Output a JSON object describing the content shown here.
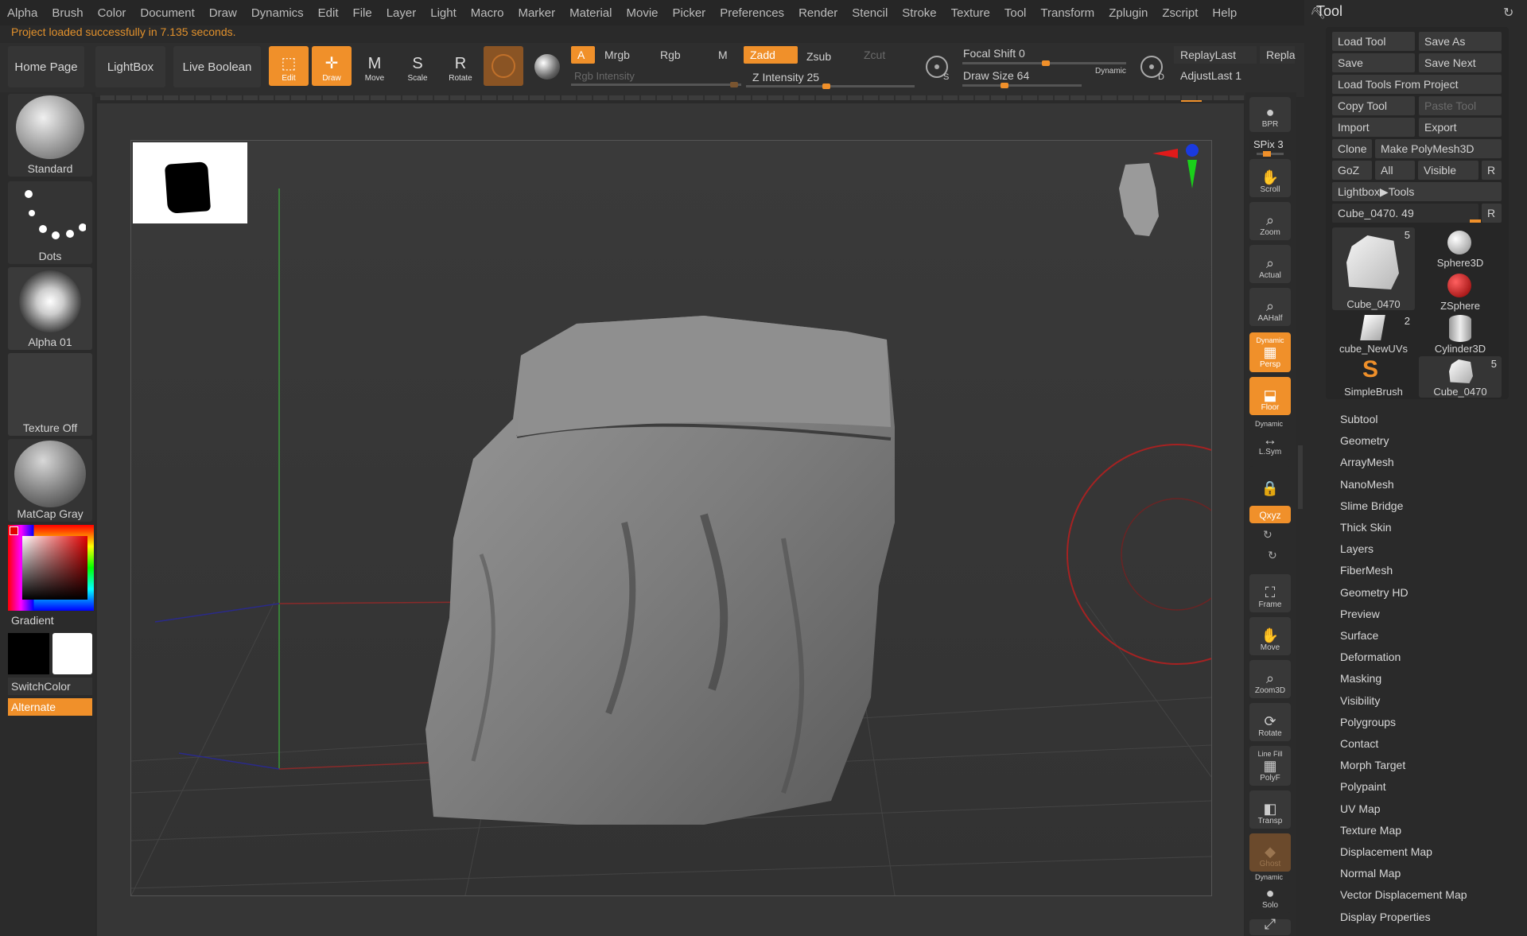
{
  "menu": [
    "Alpha",
    "Brush",
    "Color",
    "Document",
    "Draw",
    "Dynamics",
    "Edit",
    "File",
    "Layer",
    "Light",
    "Macro",
    "Marker",
    "Material",
    "Movie",
    "Picker",
    "Preferences",
    "Render",
    "Stencil",
    "Stroke",
    "Texture",
    "Tool",
    "Transform",
    "Zplugin",
    "Zscript",
    "Help"
  ],
  "status": "Project loaded successfully in 7.135 seconds.",
  "nav": {
    "home": "Home Page",
    "lightbox": "LightBox",
    "live_boolean": "Live Boolean"
  },
  "tools": {
    "edit": "Edit",
    "draw": "Draw",
    "move": "Move",
    "scale": "Scale",
    "rotate": "Rotate"
  },
  "color_modes": {
    "a": "A",
    "mrgb": "Mrgb",
    "rgb": "Rgb",
    "m": "M",
    "rgb_intensity": "Rgb Intensity"
  },
  "depth_modes": {
    "zadd": "Zadd",
    "zsub": "Zsub",
    "zcut": "Zcut",
    "z_intensity": "Z Intensity 25",
    "z_intensity_value": 25
  },
  "focal_shift": "Focal Shift 0",
  "draw_size": "Draw Size 64",
  "dynamic": "Dynamic",
  "replay_last": "ReplayLast",
  "replay_last_rel": "Repla",
  "adjust_last": "AdjustLast 1",
  "left_panel": {
    "brush": "Standard",
    "stroke": "Dots",
    "alpha": "Alpha 01",
    "texture": "Texture Off",
    "material": "MatCap Gray",
    "gradient": "Gradient",
    "switch_color": "SwitchColor",
    "alternate": "Alternate"
  },
  "shelf": {
    "bpr": "BPR",
    "spix": "SPix 3",
    "scroll": "Scroll",
    "zoom": "Zoom",
    "actual": "Actual",
    "aahalf": "AAHalf",
    "dynamic_persp": "Dynamic",
    "persp": "Persp",
    "floor": "Floor",
    "dynamic_lsym": "Dynamic",
    "lsym": "L.Sym",
    "xyz": "Qxyz",
    "frame": "Frame",
    "move": "Move",
    "zoom3d": "Zoom3D",
    "rotate": "Rotate",
    "line_fill": "Line Fill",
    "polyf": "PolyF",
    "transp": "Transp",
    "ghost": "Ghost",
    "dynamic_solo": "Dynamic",
    "solo": "Solo"
  },
  "tool_palette": {
    "title": "Tool",
    "load_tool": "Load Tool",
    "save_as": "Save As",
    "save": "Save",
    "save_next": "Save Next",
    "load_from_project": "Load Tools From Project",
    "copy_tool": "Copy Tool",
    "paste_tool": "Paste Tool",
    "import": "Import",
    "export": "Export",
    "clone": "Clone",
    "make_polymesh": "Make PolyMesh3D",
    "goz": "GoZ",
    "all": "All",
    "visible": "Visible",
    "r": "R",
    "lightbox_tools": "Lightbox▶Tools",
    "current_tool": "Cube_0470. 49",
    "thumbs": [
      {
        "name": "Cube_0470",
        "count": "5"
      },
      {
        "name": "Sphere3D",
        "count": ""
      },
      {
        "name": "ZSphere",
        "count": ""
      },
      {
        "name": "cube_NewUVs",
        "count": "2"
      },
      {
        "name": "Cylinder3D",
        "count": ""
      },
      {
        "name": "SimpleBrush",
        "count": ""
      },
      {
        "name": "Cube_0470",
        "count": "5"
      }
    ],
    "subpalettes": [
      "Subtool",
      "Geometry",
      "ArrayMesh",
      "NanoMesh",
      "Slime Bridge",
      "Thick Skin",
      "Layers",
      "FiberMesh",
      "Geometry HD",
      "Preview",
      "Surface",
      "Deformation",
      "Masking",
      "Visibility",
      "Polygroups",
      "Contact",
      "Morph Target",
      "Polypaint",
      "UV Map",
      "Texture Map",
      "Displacement Map",
      "Normal Map",
      "Vector Displacement Map",
      "Display Properties"
    ]
  },
  "colors": {
    "accent": "#f0902a",
    "panel": "#2b2b2b",
    "viewport": "#363636"
  }
}
